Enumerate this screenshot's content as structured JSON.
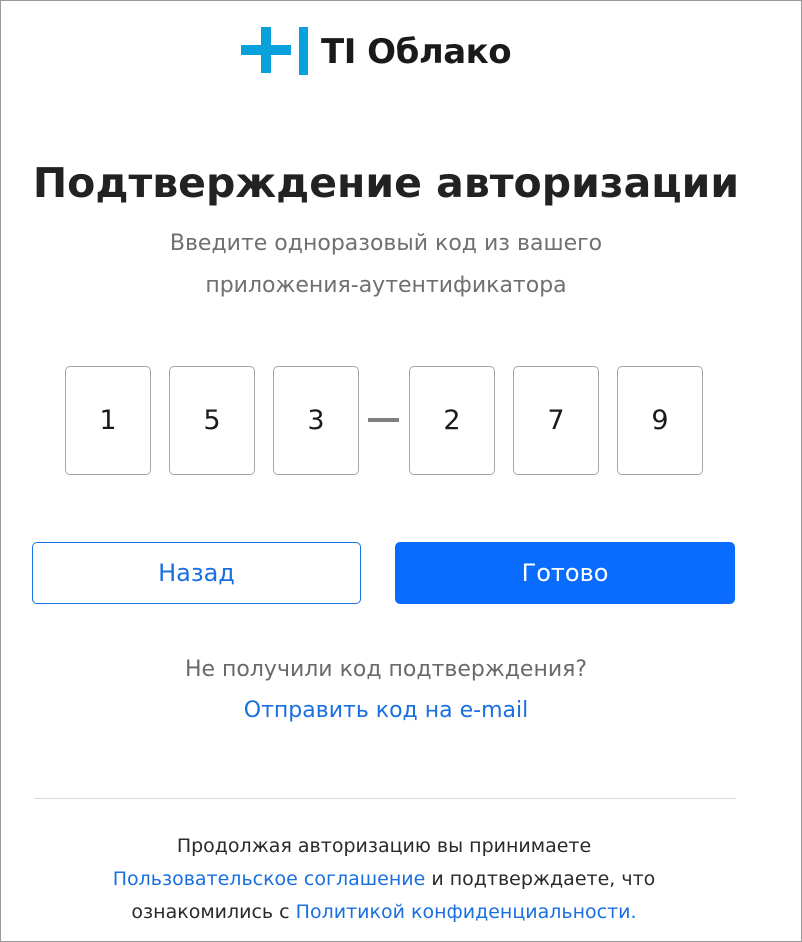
{
  "brand": {
    "name": "TI Облако",
    "accent_color": "#0aa0dc"
  },
  "header": {
    "title": "Подтверждение авторизации",
    "subtitle_line1": "Введите одноразовый код из вашего",
    "subtitle_line2": "приложения-аутентификатора"
  },
  "code": {
    "digits": [
      "1",
      "5",
      "3",
      "2",
      "7",
      "9"
    ],
    "separator": "—"
  },
  "actions": {
    "back_label": "Назад",
    "done_label": "Готово",
    "primary_color": "#0a6cff"
  },
  "resend": {
    "question": "Не получили код подтверждения?",
    "email_link": "Отправить код на e-mail"
  },
  "legal": {
    "text1": "Продолжая авторизацию вы принимаете",
    "user_agreement_link": "Пользовательское соглашение",
    "text2": " и подтверждаете, что",
    "text3": "ознакомились с ",
    "privacy_policy_link": "Политикой конфиденциальности."
  }
}
